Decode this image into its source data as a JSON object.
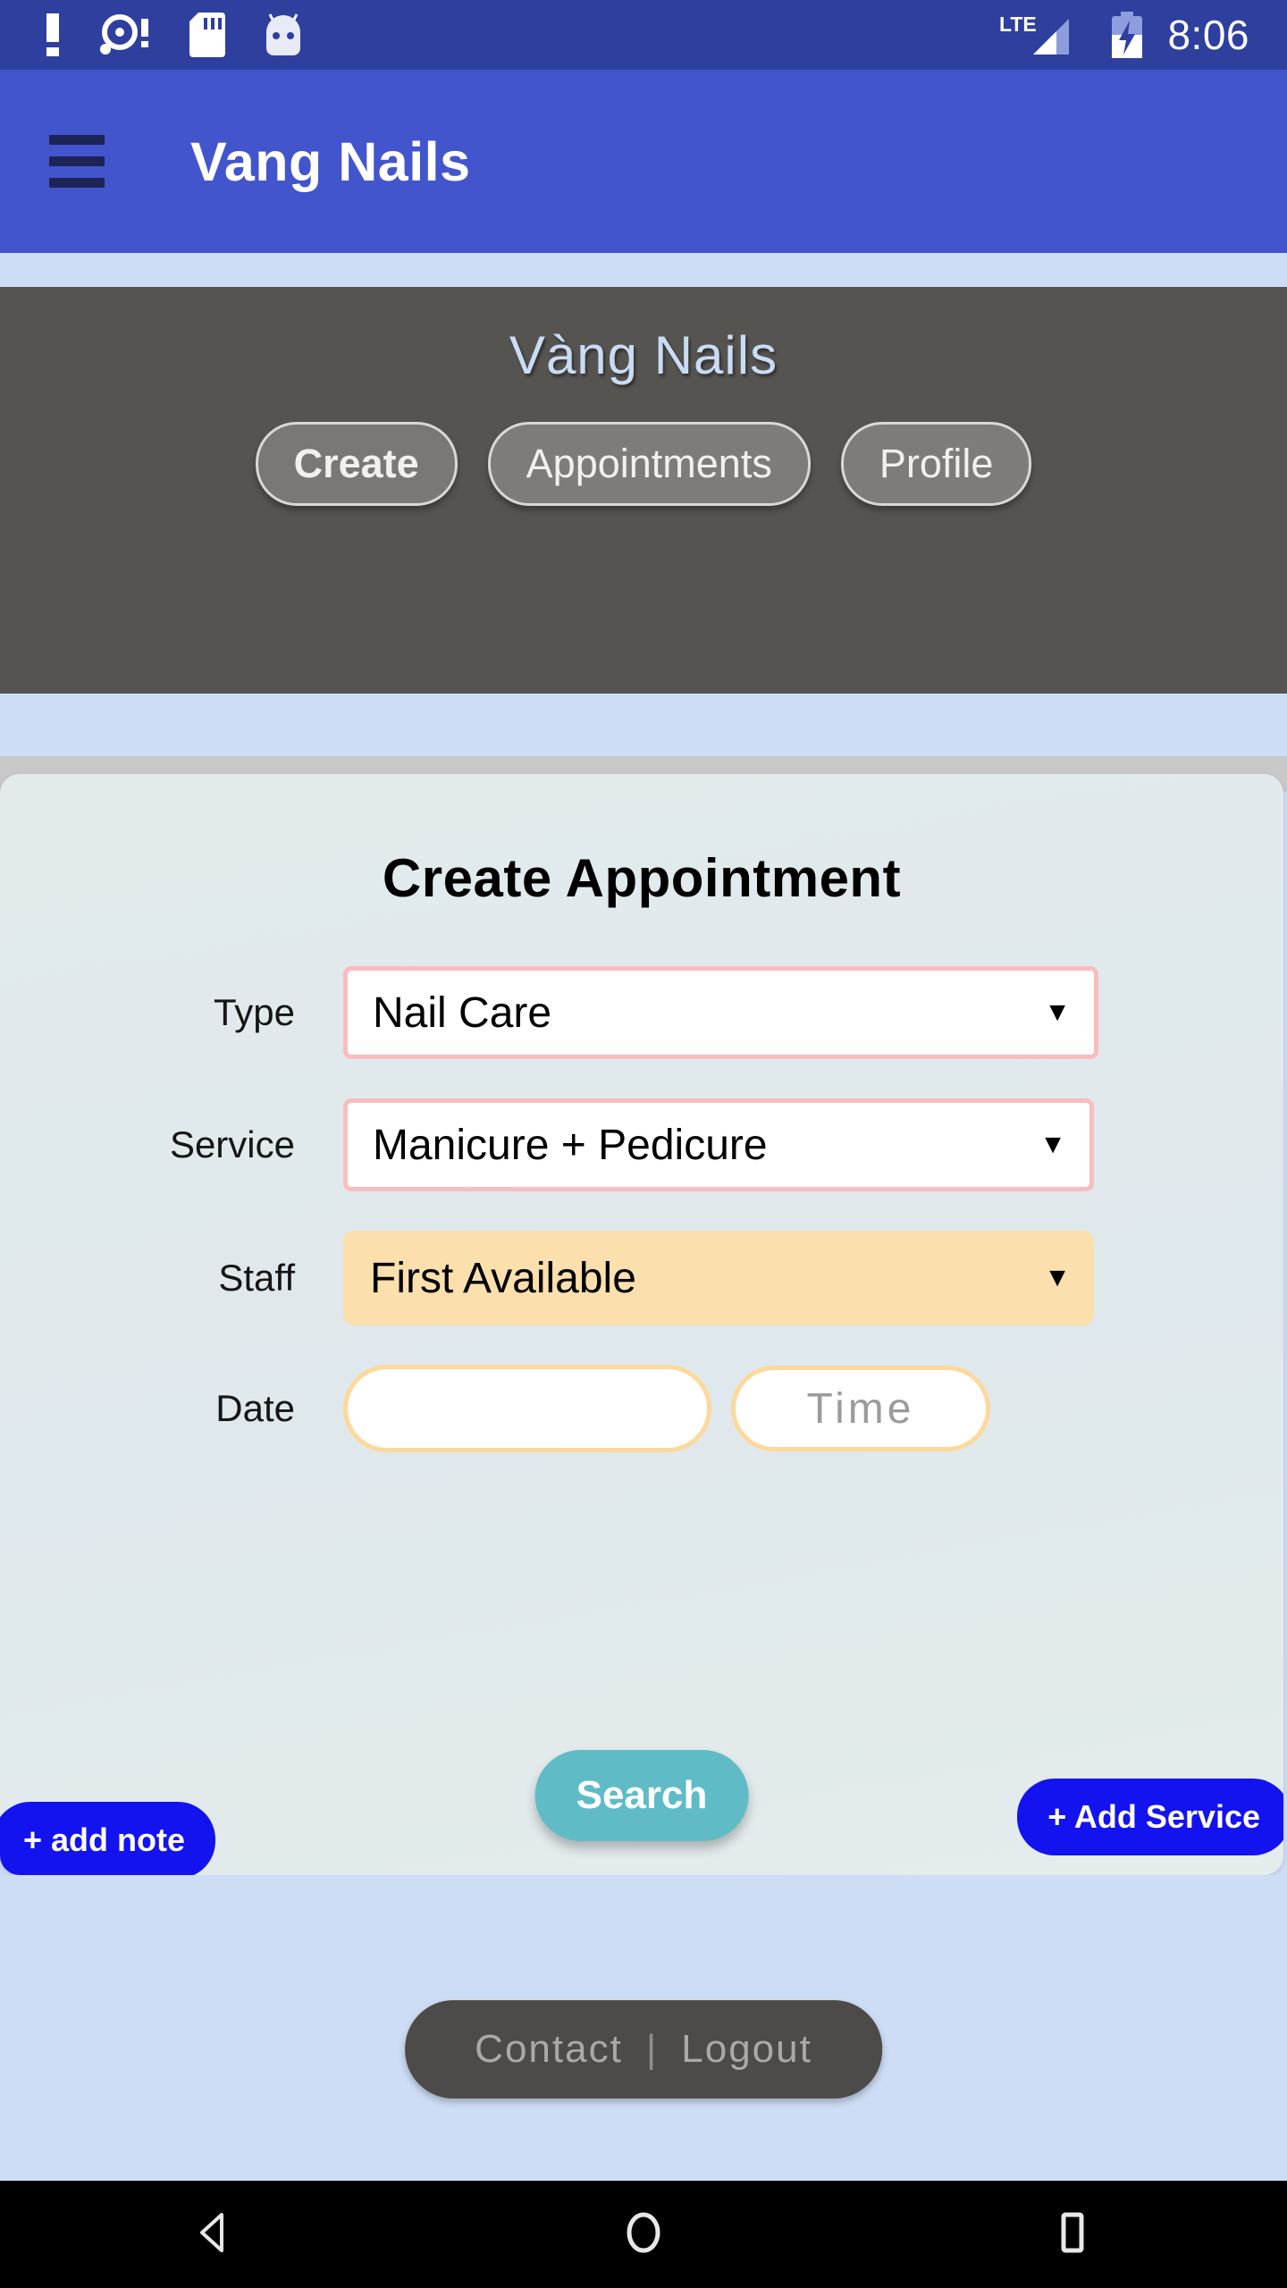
{
  "statusbar": {
    "time": "8:06",
    "network_label": "LTE",
    "icons": [
      "warning-exclamation-icon",
      "disc-alert-icon",
      "sd-card-icon",
      "android-head-icon",
      "lte-signal-icon",
      "battery-charging-icon"
    ]
  },
  "appbar": {
    "menu_icon": "hamburger-menu-icon",
    "title": "Vang Nails"
  },
  "hero": {
    "title": "Vàng Nails",
    "tabs": [
      {
        "label": "Create",
        "active": true
      },
      {
        "label": "Appointments",
        "active": false
      },
      {
        "label": "Profile",
        "active": false
      }
    ]
  },
  "form": {
    "title": "Create Appointment",
    "fields": {
      "type": {
        "label": "Type",
        "value": "Nail Care",
        "caret": "▼"
      },
      "service": {
        "label": "Service",
        "value": "Manicure + Pedicure",
        "caret": "▼"
      },
      "staff": {
        "label": "Staff",
        "value": "First Available",
        "caret": "▼"
      },
      "date": {
        "label": "Date",
        "value": "",
        "placeholder": ""
      },
      "time": {
        "value": "",
        "placeholder": "Time"
      }
    },
    "buttons": {
      "add_note": "+ add note",
      "search": "Search",
      "add_service": "+ Add Service"
    }
  },
  "footer": {
    "contact": "Contact",
    "separator": "|",
    "logout": "Logout"
  },
  "navbar": {
    "back": "back-triangle-icon",
    "home": "home-circle-icon",
    "recents": "recents-square-icon"
  },
  "colors": {
    "statusbar": "#2e3f9e",
    "appbar": "#4255cd",
    "page_background": "#cdddf5",
    "hero": "#565451",
    "card": "#e2eaec",
    "field_border_pink": "#f9bdbd",
    "field_fill_peach": "#fbdfac",
    "field_border_orange": "#fcd99b",
    "button_blue": "#1313ef",
    "button_teal": "#5fbcc6",
    "footer_pill": "#4d4b49"
  }
}
